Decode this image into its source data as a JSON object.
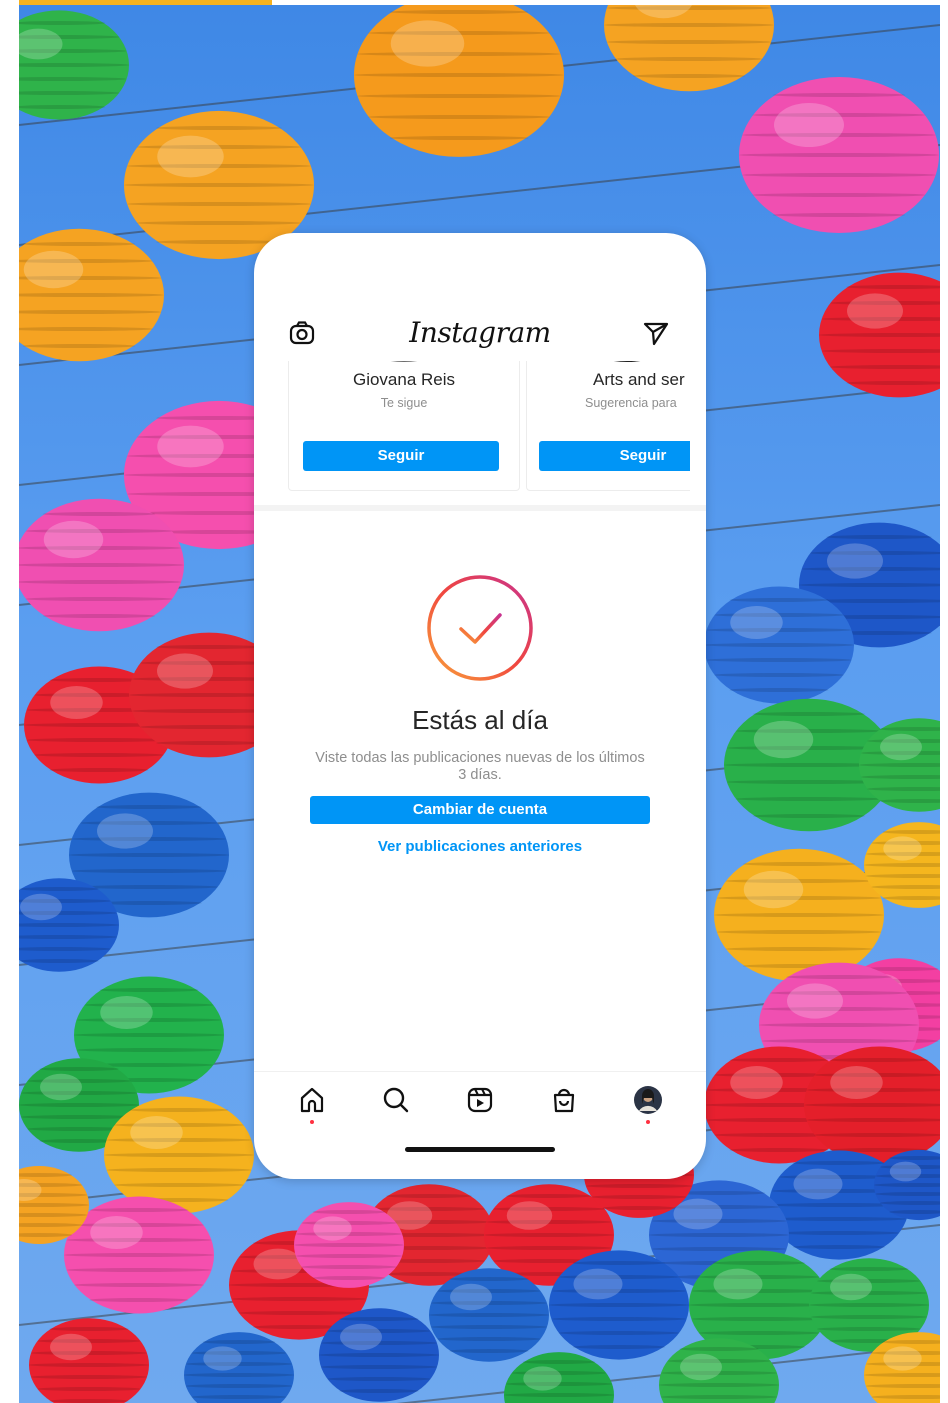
{
  "app": {
    "logo_text": "Instagram"
  },
  "suggestions": [
    {
      "name": "Giovana Reis",
      "subtitle": "Te sigue",
      "button": "Seguir"
    },
    {
      "name": "Arts and ser",
      "subtitle": "Sugerencia para",
      "button": "Seguir"
    }
  ],
  "caught_up": {
    "title": "Estás al día",
    "message": "Viste todas las publicaciones nuevas de los últimos 3 días.",
    "switch_button": "Cambiar de cuenta",
    "older_link": "Ver publicaciones anteriores"
  },
  "nav": {
    "items": [
      "home-icon",
      "search-icon",
      "reels-icon",
      "shop-icon",
      "profile-avatar"
    ],
    "active_dot_color": "#ff3040"
  },
  "colors": {
    "accent": "#0095f6",
    "gradient_start": "#f58529",
    "gradient_end": "#dd2a7b",
    "top_accent_bar": "#f5b21e"
  }
}
